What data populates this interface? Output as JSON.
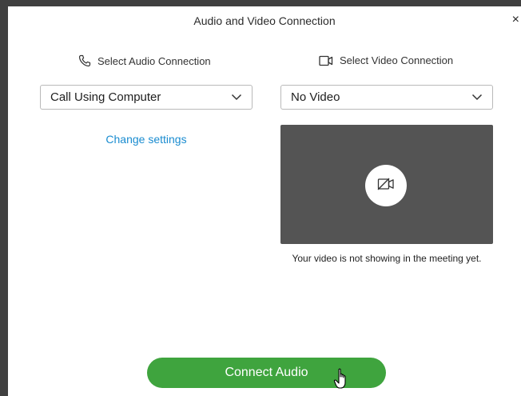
{
  "dialog": {
    "title": "Audio and Video Connection",
    "close_glyph": "×"
  },
  "audio": {
    "heading": "Select Audio Connection",
    "heading_icon": "phone-icon",
    "selected": "Call Using Computer",
    "change_settings": "Change settings"
  },
  "video": {
    "heading": "Select Video Connection",
    "heading_icon": "camera-icon",
    "selected": "No Video",
    "preview_icon": "camera-off-icon",
    "note": "Your video is not showing in the meeting yet."
  },
  "footer": {
    "connect_label": "Connect Audio"
  },
  "colors": {
    "accent_green": "#3fa43e",
    "link_blue": "#1a8cd0",
    "preview_bg": "#545454",
    "frame": "#404040"
  }
}
